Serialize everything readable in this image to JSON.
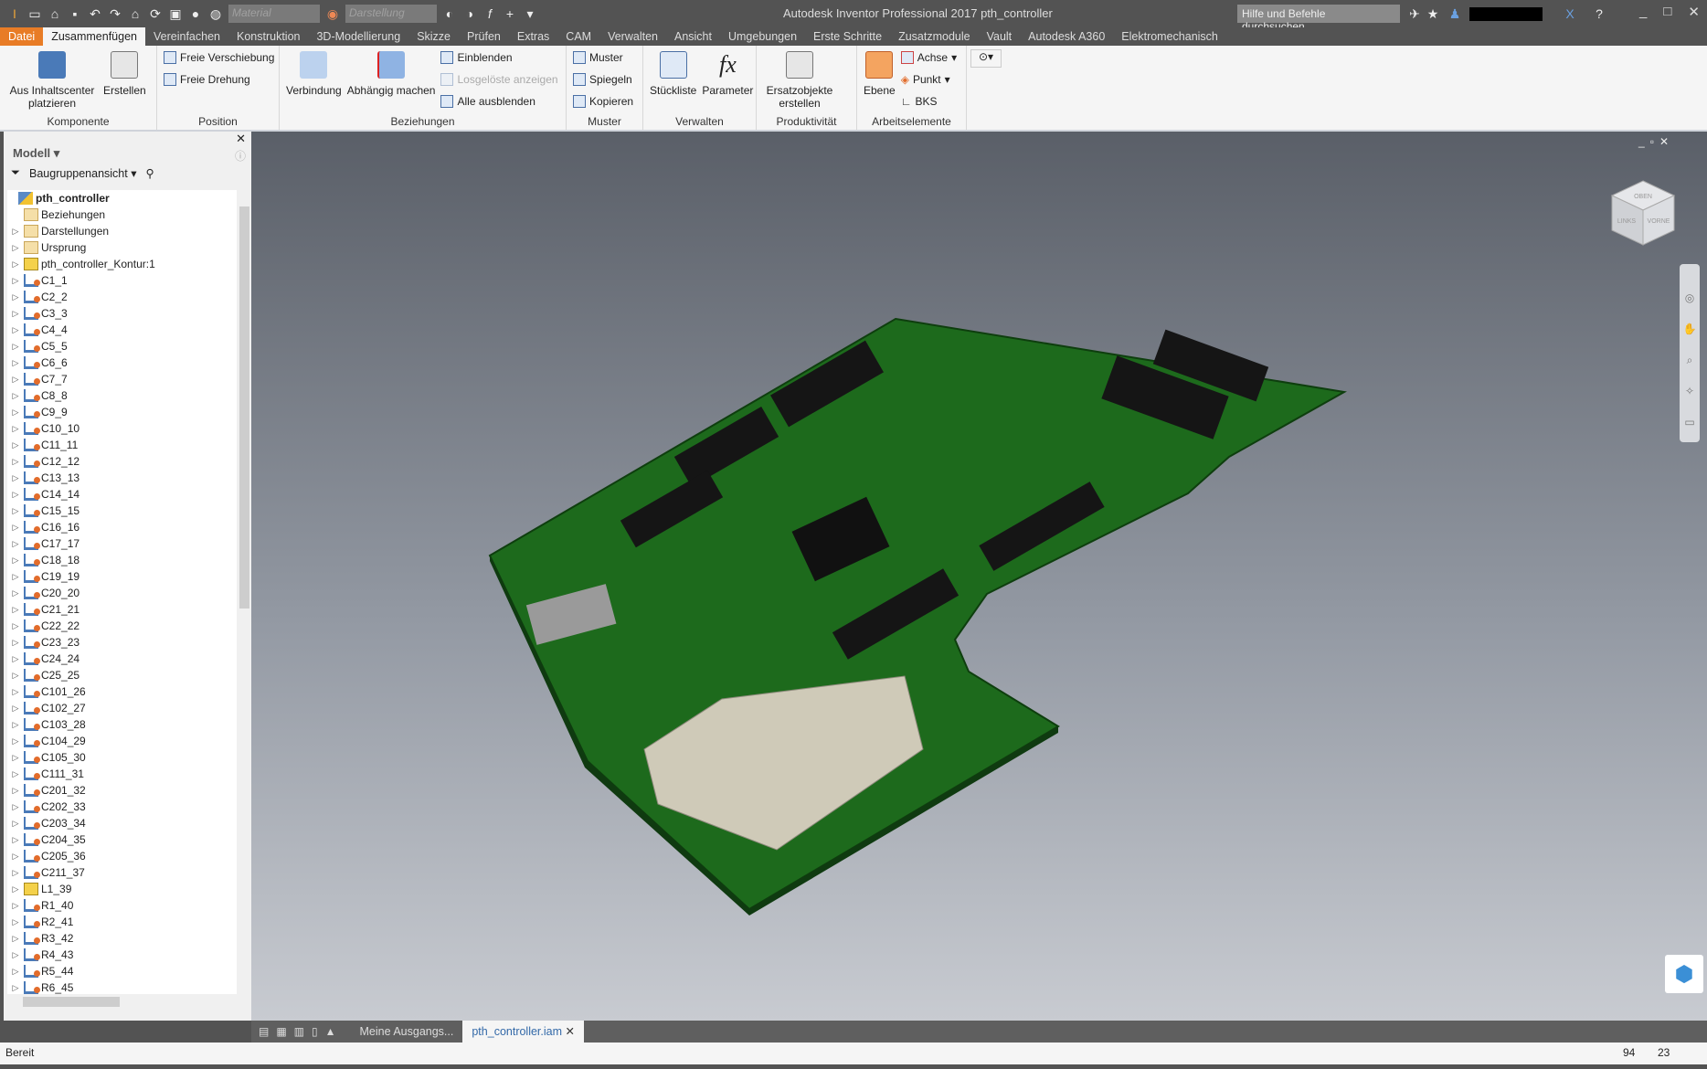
{
  "titlebar": {
    "app_title": "Autodesk Inventor Professional 2017   pth_controller",
    "material_placeholder": "Material",
    "appearance_placeholder": "Darstellung",
    "search_placeholder": "Hilfe und Befehle durchsuchen..."
  },
  "tabs": [
    "Datei",
    "Zusammenfügen",
    "Vereinfachen",
    "Konstruktion",
    "3D-Modellierung",
    "Skizze",
    "Prüfen",
    "Extras",
    "CAM",
    "Verwalten",
    "Ansicht",
    "Umgebungen",
    "Erste Schritte",
    "Zusatzmodule",
    "Vault",
    "Autodesk A360",
    "Elektromechanisch"
  ],
  "active_tab": "Zusammenfügen",
  "ribbon": {
    "komponente": {
      "label": "Komponente",
      "place": "Aus Inhaltscenter platzieren",
      "create": "Erstellen"
    },
    "position": {
      "label": "Position",
      "free_move": "Freie Verschiebung",
      "free_rotate": "Freie Drehung"
    },
    "beziehungen": {
      "label": "Beziehungen",
      "joint": "Verbindung",
      "constrain": "Abhängig machen",
      "show": "Einblenden",
      "show_sick": "Losgelöste anzeigen",
      "hide_all": "Alle ausblenden"
    },
    "muster": {
      "label": "Muster",
      "pattern": "Muster",
      "mirror": "Spiegeln",
      "copy": "Kopieren"
    },
    "verwalten": {
      "label": "Verwalten",
      "bom": "Stückliste",
      "params": "Parameter"
    },
    "produktivitaet": {
      "label": "Produktivität",
      "substitutes": "Ersatzobjekte erstellen"
    },
    "arbeitselemente": {
      "label": "Arbeitselemente",
      "plane": "Ebene",
      "axis": "Achse",
      "point": "Punkt",
      "ucs": "BKS"
    }
  },
  "browser": {
    "title": "Modell",
    "view": "Baugruppenansicht",
    "items": [
      {
        "label": "pth_controller",
        "icon": "asm",
        "bold": true,
        "expander": false
      },
      {
        "label": "Beziehungen",
        "icon": "folder",
        "expander": false
      },
      {
        "label": "Darstellungen",
        "icon": "folder",
        "expander": true
      },
      {
        "label": "Ursprung",
        "icon": "folder",
        "expander": true
      },
      {
        "label": "pth_controller_Kontur:1",
        "icon": "sketch",
        "expander": true
      },
      {
        "label": "C1_1",
        "icon": "part"
      },
      {
        "label": "C2_2",
        "icon": "part"
      },
      {
        "label": "C3_3",
        "icon": "part"
      },
      {
        "label": "C4_4",
        "icon": "part"
      },
      {
        "label": "C5_5",
        "icon": "part"
      },
      {
        "label": "C6_6",
        "icon": "part"
      },
      {
        "label": "C7_7",
        "icon": "part"
      },
      {
        "label": "C8_8",
        "icon": "part"
      },
      {
        "label": "C9_9",
        "icon": "part"
      },
      {
        "label": "C10_10",
        "icon": "part"
      },
      {
        "label": "C11_11",
        "icon": "part"
      },
      {
        "label": "C12_12",
        "icon": "part"
      },
      {
        "label": "C13_13",
        "icon": "part"
      },
      {
        "label": "C14_14",
        "icon": "part"
      },
      {
        "label": "C15_15",
        "icon": "part"
      },
      {
        "label": "C16_16",
        "icon": "part"
      },
      {
        "label": "C17_17",
        "icon": "part"
      },
      {
        "label": "C18_18",
        "icon": "part"
      },
      {
        "label": "C19_19",
        "icon": "part"
      },
      {
        "label": "C20_20",
        "icon": "part"
      },
      {
        "label": "C21_21",
        "icon": "part"
      },
      {
        "label": "C22_22",
        "icon": "part"
      },
      {
        "label": "C23_23",
        "icon": "part"
      },
      {
        "label": "C24_24",
        "icon": "part"
      },
      {
        "label": "C25_25",
        "icon": "part"
      },
      {
        "label": "C101_26",
        "icon": "part"
      },
      {
        "label": "C102_27",
        "icon": "part"
      },
      {
        "label": "C103_28",
        "icon": "part"
      },
      {
        "label": "C104_29",
        "icon": "part"
      },
      {
        "label": "C105_30",
        "icon": "part"
      },
      {
        "label": "C111_31",
        "icon": "part"
      },
      {
        "label": "C201_32",
        "icon": "part"
      },
      {
        "label": "C202_33",
        "icon": "part"
      },
      {
        "label": "C203_34",
        "icon": "part"
      },
      {
        "label": "C204_35",
        "icon": "part"
      },
      {
        "label": "C205_36",
        "icon": "part"
      },
      {
        "label": "C211_37",
        "icon": "part"
      },
      {
        "label": "L1_39",
        "icon": "sketch"
      },
      {
        "label": "R1_40",
        "icon": "part"
      },
      {
        "label": "R2_41",
        "icon": "part"
      },
      {
        "label": "R3_42",
        "icon": "part"
      },
      {
        "label": "R4_43",
        "icon": "part"
      },
      {
        "label": "R5_44",
        "icon": "part"
      },
      {
        "label": "R6_45",
        "icon": "part"
      }
    ]
  },
  "viewcube": {
    "top": "OBEN",
    "left": "LINKS",
    "front": "VORNE"
  },
  "doc_tabs": [
    {
      "label": "Meine Ausgangs...",
      "active": false
    },
    {
      "label": "pth_controller.iam",
      "active": true
    }
  ],
  "status": {
    "text": "Bereit",
    "count1": "94",
    "count2": "23"
  },
  "colors": {
    "file_tab": "#e87c26",
    "pcb": "#1f6b1f",
    "accent": "#3369a8"
  }
}
